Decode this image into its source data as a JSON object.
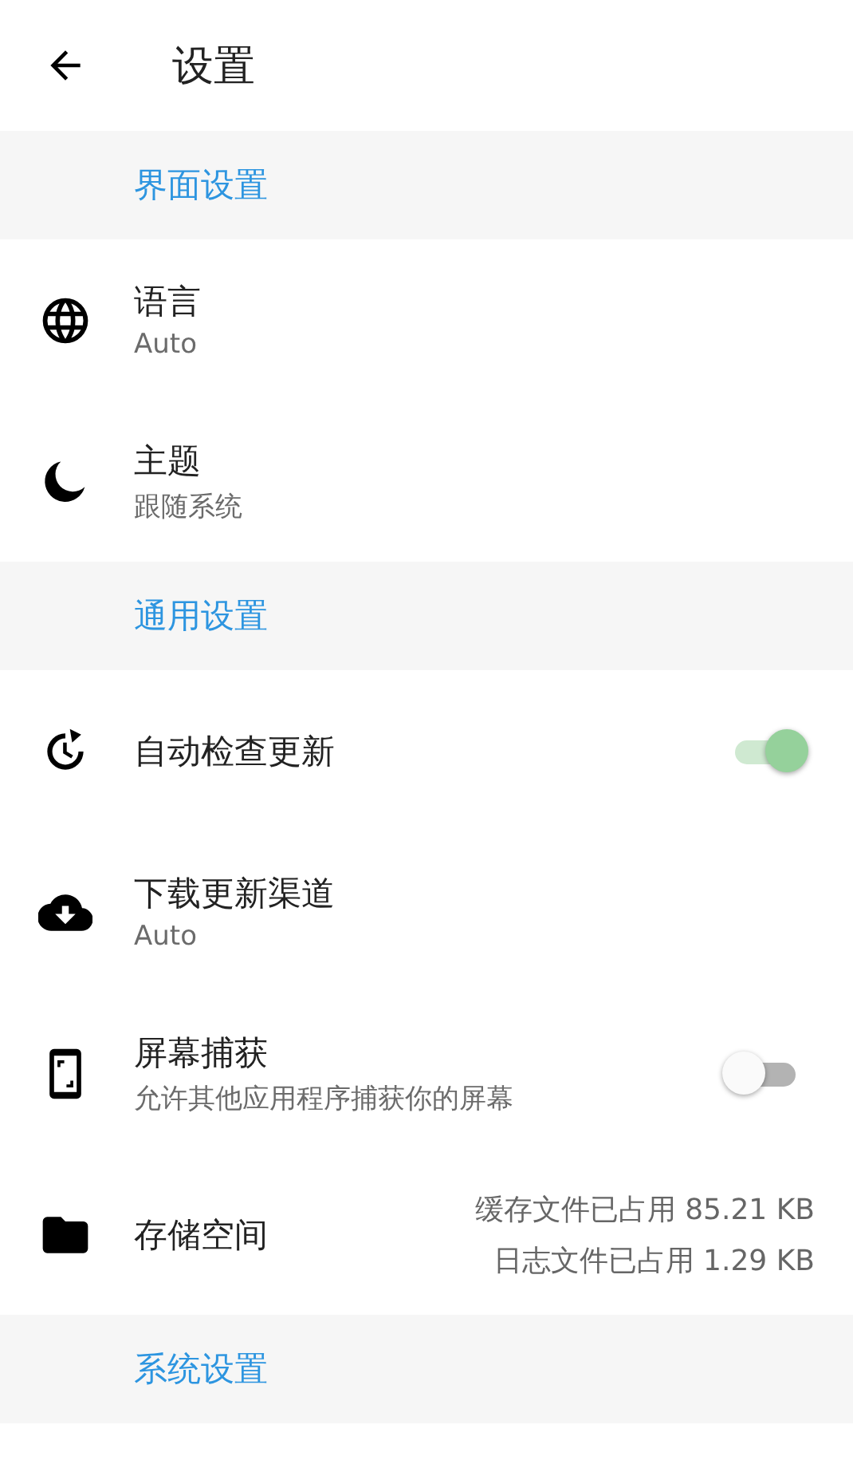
{
  "app_bar": {
    "title": "设置"
  },
  "sections": [
    {
      "title": "界面设置",
      "items": [
        {
          "kind": "plain",
          "title": "语言",
          "subtitle": "Auto"
        },
        {
          "kind": "plain",
          "title": "主题",
          "subtitle": "跟随系统"
        }
      ]
    },
    {
      "title": "通用设置",
      "items": [
        {
          "kind": "toggle",
          "title": "自动检查更新",
          "on": true
        },
        {
          "kind": "plain",
          "title": "下载更新渠道",
          "subtitle": "Auto"
        },
        {
          "kind": "toggle",
          "title": "屏幕捕获",
          "subtitle": "允许其他应用程序捕获你的屏幕",
          "on": false
        },
        {
          "kind": "storage",
          "title": "存储空间",
          "details": [
            "缓存文件已占用 85.21 KB",
            "日志文件已占用 1.29 KB"
          ]
        }
      ]
    },
    {
      "title": "系统设置"
    }
  ]
}
